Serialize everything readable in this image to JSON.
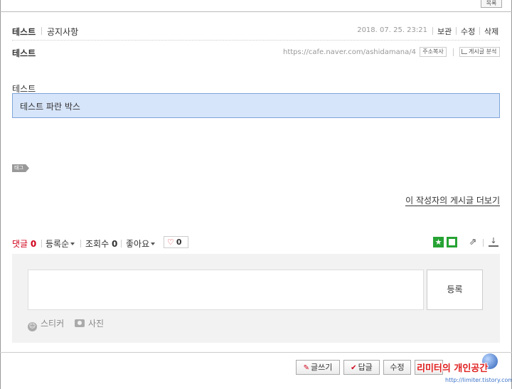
{
  "top_button": "목록",
  "post": {
    "title": "테스트",
    "category": "공지사항",
    "date": "2018. 07. 25.  23:21",
    "actions": [
      "보관",
      "수정",
      "삭제"
    ],
    "subject": "테스트",
    "url": "https://cafe.naver.com/ashidamana/4",
    "copy_label": "주소복사",
    "analysis_label": "게시글 분석",
    "body_label": "테스트",
    "blue_box_text": "테스트 파란 박스",
    "tag_label": "태그",
    "more_link": "이 작성자의 게시글 더보기"
  },
  "comment_bar": {
    "comments_label": "댓글",
    "comments_count": "0",
    "sort_label": "등록순",
    "views_label": "조회수",
    "views_count": "0",
    "likes_label": "좋아요",
    "like_heart": "♡",
    "like_count": "0",
    "star_glyph": "★",
    "share_glyph": "⇗",
    "download_glyph": "↓"
  },
  "comment_form": {
    "input_placeholder": "",
    "submit_label": "등록",
    "sticker_label": "스티커",
    "photo_label": "사진"
  },
  "bottom_buttons": {
    "write_label": "글쓰기",
    "reply_label": "답글",
    "edit_label": "수정",
    "move_label": "이동"
  },
  "watermark": {
    "text": "리미터의 개인공간",
    "url": "http://limiter.tistory.com"
  },
  "colors": {
    "accent_red": "#d0021b",
    "box_blue": "#d7e5fa",
    "box_border": "#7fa4d9",
    "green": "#27a334"
  }
}
